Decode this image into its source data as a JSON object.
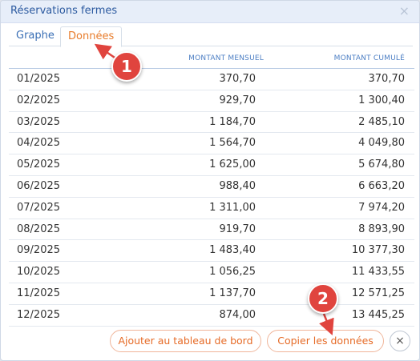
{
  "dialog": {
    "title": "Réservations fermes",
    "close_glyph": "×"
  },
  "tabs": [
    {
      "label": "Graphe",
      "active": false
    },
    {
      "label": "Données",
      "active": true
    }
  ],
  "table": {
    "headers": {
      "month": "",
      "monthly": "MONTANT MENSUEL",
      "cumulative": "MONTANT CUMULÉ"
    },
    "rows": [
      {
        "month": "01/2025",
        "monthly": "370,70",
        "cumulative": "370,70"
      },
      {
        "month": "02/2025",
        "monthly": "929,70",
        "cumulative": "1 300,40"
      },
      {
        "month": "03/2025",
        "monthly": "1 184,70",
        "cumulative": "2 485,10"
      },
      {
        "month": "04/2025",
        "monthly": "1 564,70",
        "cumulative": "4 049,80"
      },
      {
        "month": "05/2025",
        "monthly": "1 625,00",
        "cumulative": "5 674,80"
      },
      {
        "month": "06/2025",
        "monthly": "988,40",
        "cumulative": "6 663,20"
      },
      {
        "month": "07/2025",
        "monthly": "1 311,00",
        "cumulative": "7 974,20"
      },
      {
        "month": "08/2025",
        "monthly": "919,70",
        "cumulative": "8 893,90"
      },
      {
        "month": "09/2025",
        "monthly": "1 483,40",
        "cumulative": "10 377,30"
      },
      {
        "month": "10/2025",
        "monthly": "1 056,25",
        "cumulative": "11 433,55"
      },
      {
        "month": "11/2025",
        "monthly": "1 137,70",
        "cumulative": "12 571,25"
      },
      {
        "month": "12/2025",
        "monthly": "874,00",
        "cumulative": "13 445,25"
      }
    ]
  },
  "footer": {
    "add_to_dashboard": "Ajouter au tableau de bord",
    "copy_data": "Copier les données",
    "close_glyph": "×"
  },
  "callouts": [
    {
      "number": "1"
    },
    {
      "number": "2"
    }
  ],
  "colors": {
    "accent_orange": "#e66b27",
    "title_blue": "#2c5aa0",
    "header_blue": "#4d7fc4",
    "callout_red": "#e0443e"
  }
}
